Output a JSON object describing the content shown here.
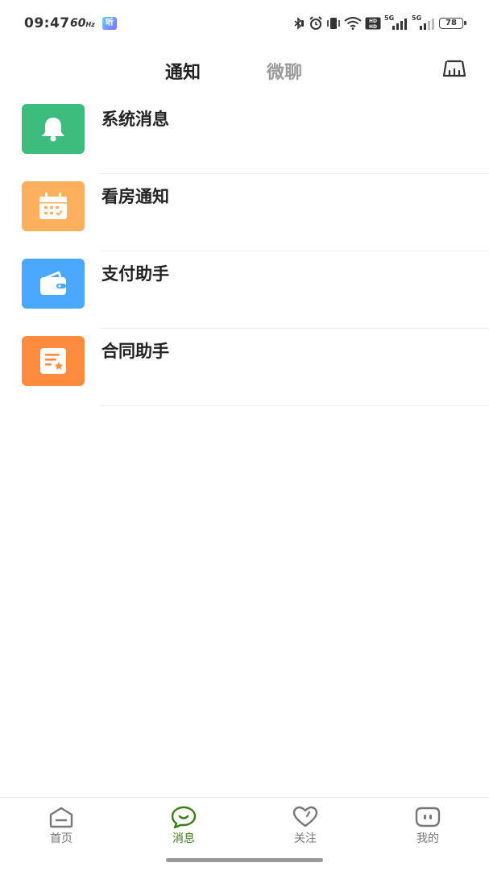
{
  "status_bar": {
    "time": "09:47",
    "refresh_rate": "60",
    "refresh_unit": "Hz",
    "app_badge": "听",
    "network_1": "5G",
    "network_2": "5G",
    "hd_label": "HD",
    "battery": "78"
  },
  "top_nav": {
    "tabs": [
      {
        "label": "通知",
        "active": true
      },
      {
        "label": "微聊",
        "active": false
      }
    ],
    "right_icon": "broom-clean-icon"
  },
  "notifications": [
    {
      "label": "系统消息",
      "icon": "bell-icon",
      "color": "#3dbd7d"
    },
    {
      "label": "看房通知",
      "icon": "calendar-icon",
      "color": "#ffb05c"
    },
    {
      "label": "支付助手",
      "icon": "wallet-icon",
      "color": "#4aa8ff"
    },
    {
      "label": "合同助手",
      "icon": "contract-icon",
      "color": "#ff8c3e"
    }
  ],
  "bottom_nav": {
    "items": [
      {
        "label": "首页",
        "icon": "home-icon",
        "active": false
      },
      {
        "label": "消息",
        "icon": "message-icon",
        "active": true
      },
      {
        "label": "关注",
        "icon": "heart-icon",
        "active": false
      },
      {
        "label": "我的",
        "icon": "profile-face-icon",
        "active": false
      }
    ],
    "active_color": "#3a7d18",
    "inactive_color": "#777777"
  }
}
